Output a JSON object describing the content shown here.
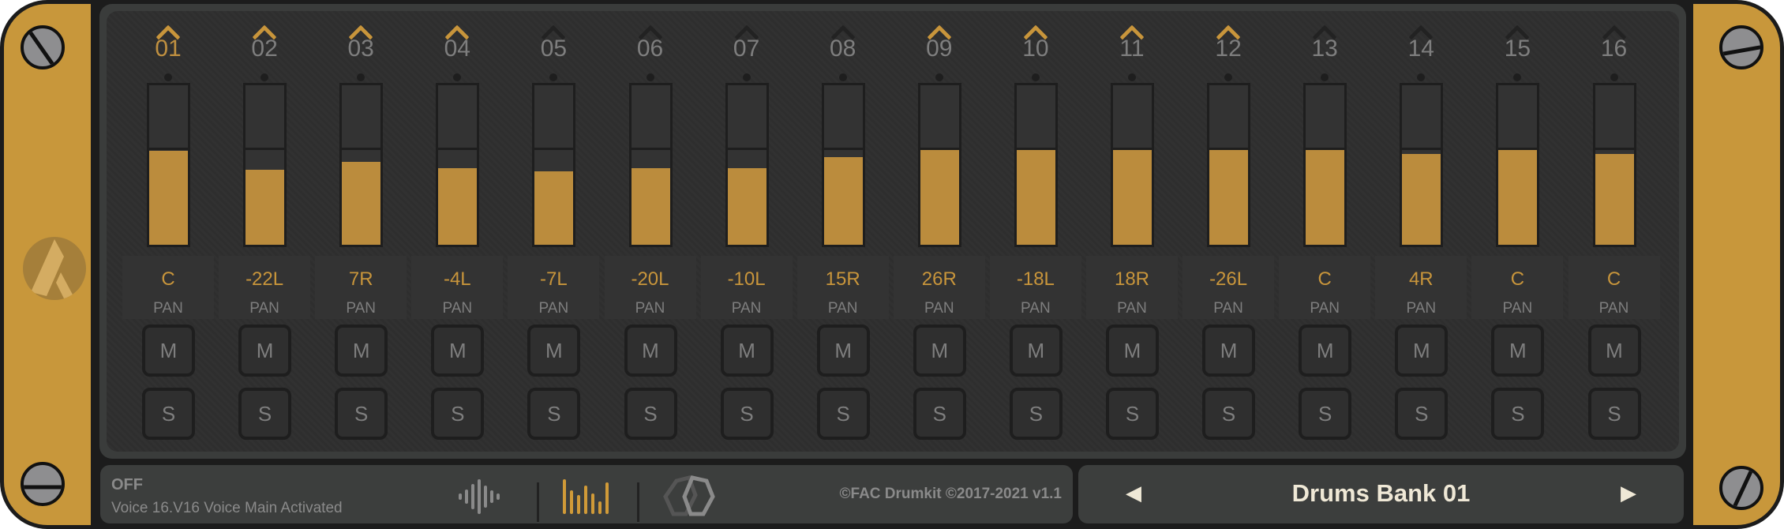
{
  "colors": {
    "gold": "#c8973b",
    "fill": "#bb8c3d",
    "panel": "#2e2e2e"
  },
  "channels": [
    {
      "num": "01",
      "active": true,
      "selected": true,
      "level": 0.59,
      "pan": "C"
    },
    {
      "num": "02",
      "active": true,
      "selected": false,
      "level": 0.47,
      "pan": "-22L"
    },
    {
      "num": "03",
      "active": true,
      "selected": false,
      "level": 0.52,
      "pan": "7R"
    },
    {
      "num": "04",
      "active": true,
      "selected": false,
      "level": 0.48,
      "pan": "-4L"
    },
    {
      "num": "05",
      "active": false,
      "selected": false,
      "level": 0.46,
      "pan": "-7L"
    },
    {
      "num": "06",
      "active": false,
      "selected": false,
      "level": 0.48,
      "pan": "-20L"
    },
    {
      "num": "07",
      "active": false,
      "selected": false,
      "level": 0.48,
      "pan": "-10L"
    },
    {
      "num": "08",
      "active": false,
      "selected": false,
      "level": 0.55,
      "pan": "15R"
    },
    {
      "num": "09",
      "active": true,
      "selected": false,
      "level": 0.6,
      "pan": "26R"
    },
    {
      "num": "10",
      "active": true,
      "selected": false,
      "level": 0.6,
      "pan": "-18L"
    },
    {
      "num": "11",
      "active": true,
      "selected": false,
      "level": 0.6,
      "pan": "18R"
    },
    {
      "num": "12",
      "active": true,
      "selected": false,
      "level": 0.6,
      "pan": "-26L"
    },
    {
      "num": "13",
      "active": false,
      "selected": false,
      "level": 0.6,
      "pan": "C"
    },
    {
      "num": "14",
      "active": false,
      "selected": false,
      "level": 0.57,
      "pan": "4R"
    },
    {
      "num": "15",
      "active": false,
      "selected": false,
      "level": 0.6,
      "pan": "C"
    },
    {
      "num": "16",
      "active": false,
      "selected": false,
      "level": 0.57,
      "pan": "C"
    }
  ],
  "labels": {
    "pan": "PAN",
    "mute": "M",
    "solo": "S"
  },
  "footer": {
    "status": "OFF",
    "voice": "Voice 16.V16 Voice Main Activated",
    "copyright": "©FAC Drumkit ©2017-2021 v1.1"
  },
  "bank": {
    "name": "Drums Bank 01",
    "prev": "◀",
    "next": "▶"
  }
}
